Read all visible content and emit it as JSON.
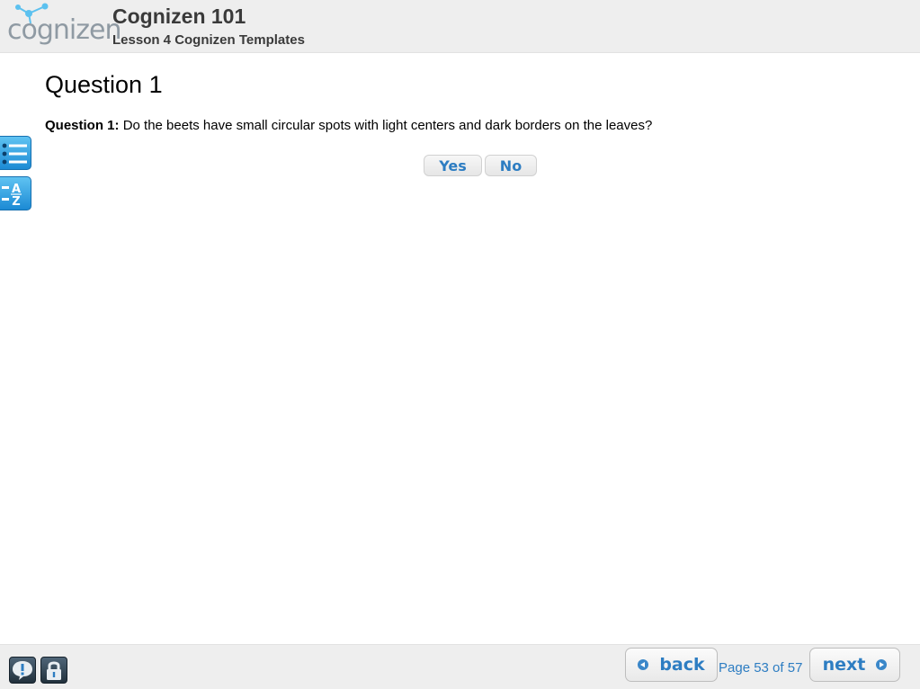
{
  "header": {
    "logo_text": "cognizen",
    "course_title": "Cognizen 101",
    "lesson_title": "Lesson 4 Cognizen Templates"
  },
  "main": {
    "page_heading": "Question 1",
    "question_label": "Question 1:",
    "question_text": "Do the beets have small circular spots with light centers and dark borders on the leaves?",
    "answers": [
      {
        "label": "Yes"
      },
      {
        "label": "No"
      }
    ]
  },
  "sidebar": {
    "icons": [
      "index-list-icon",
      "glossary-az-icon"
    ]
  },
  "footer": {
    "icons": [
      "help-icon",
      "lock-icon"
    ],
    "back_label": "back",
    "next_label": "next",
    "page_indicator": "Page 53 of 57"
  },
  "colors": {
    "accent_blue": "#2d7dc2",
    "sidebar_blue": "#1c8ad4",
    "header_bg": "#eeeeee"
  }
}
